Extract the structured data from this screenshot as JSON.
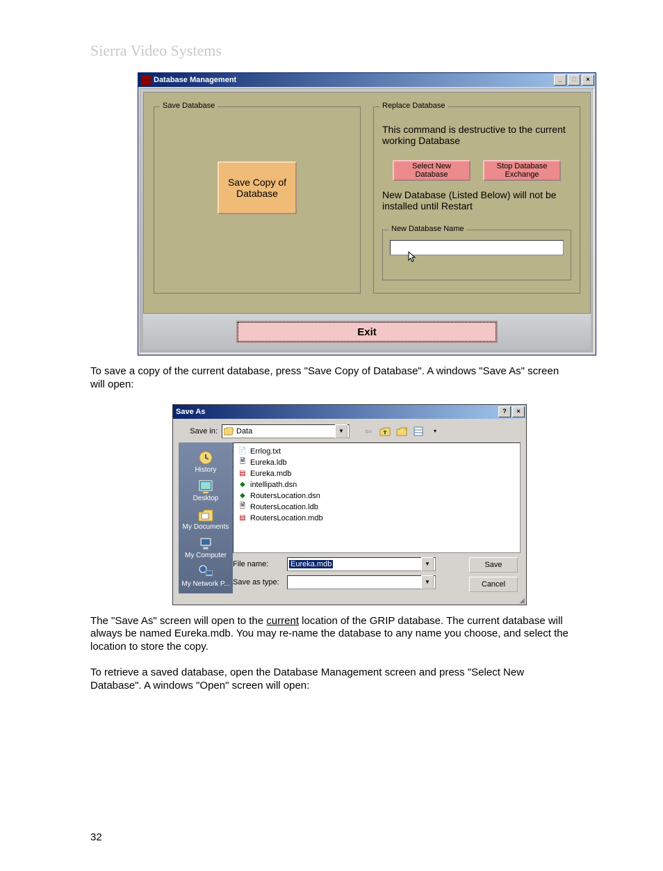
{
  "doc": {
    "header": "Sierra Video Systems",
    "page_number": "32",
    "para1": "To save a copy of the current database, press \"Save Copy of Database\". A windows \"Save As\" screen will open:",
    "para2a": "The \"Save As\" screen will open to the ",
    "para2_underlined": "current",
    "para2b": " location of the GRIP database. The current database will always be named Eureka.mdb. You may re-name the database to any name you choose, and select the location to store the copy.",
    "para3": "To retrieve a saved database, open the Database Management screen and press \"Select New Database\". A windows \"Open\" screen will open:"
  },
  "dbmgmt": {
    "title": "Database Management",
    "save_group": "Save Database",
    "save_copy_btn": "Save Copy of Database",
    "replace_group": "Replace Database",
    "warning": "This command is destructive to the current working Database",
    "select_new_btn": "Select New Database",
    "stop_exchange_btn": "Stop Database Exchange",
    "below_text": "New Database (Listed Below) will not be installed until Restart",
    "newdb_group": "New Database Name",
    "exit_btn": "Exit",
    "min": "_",
    "max": "□",
    "close": "×"
  },
  "saveas": {
    "title": "Save As",
    "help": "?",
    "close": "×",
    "savein_label": "Save in:",
    "savein_value": "Data",
    "nav": {
      "history": "History",
      "desktop": "Desktop",
      "mydocs": "My Documents",
      "mycomp": "My Computer",
      "mynet": "My Network P..."
    },
    "files": [
      "Errlog.txt",
      "Eureka.ldb",
      "Eureka.mdb",
      "intellipath.dsn",
      "RoutersLocation.dsn",
      "RoutersLocation.ldb",
      "RoutersLocation.mdb"
    ],
    "filename_label": "File name:",
    "filename_value": "Eureka.mdb",
    "saveastype_label": "Save as type:",
    "saveastype_value": "",
    "save_btn": "Save",
    "cancel_btn": "Cancel"
  }
}
